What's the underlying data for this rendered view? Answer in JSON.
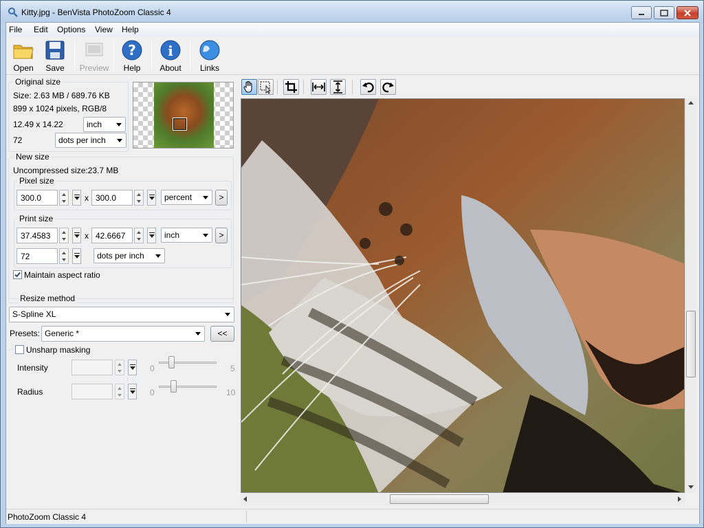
{
  "window": {
    "title": "Kitty.jpg - BenVista PhotoZoom Classic 4"
  },
  "menu": [
    "File",
    "Edit",
    "Options",
    "View",
    "Help"
  ],
  "toolbar": {
    "open": "Open",
    "save": "Save",
    "preview": "Preview",
    "help": "Help",
    "about": "About",
    "links": "Links"
  },
  "original": {
    "title": "Original size",
    "size": "Size: 2.63 MB / 689.76 KB",
    "pixels": "899 x 1024 pixels, RGB/8",
    "dimensions": "12.49 x 14.22",
    "unit": "inch",
    "resolution": "72",
    "res_unit": "dots per inch"
  },
  "newsize": {
    "title": "New size",
    "uncompressed": "Uncompressed size:23.7 MB",
    "pixel_title": "Pixel size",
    "pixel_w": "300.0",
    "pixel_h": "300.0",
    "pixel_unit": "percent",
    "x": "x",
    "more": ">",
    "print_title": "Print size",
    "print_w": "37.4583",
    "print_h": "42.6667",
    "print_unit": "inch",
    "print_res": "72",
    "print_res_unit": "dots per inch",
    "aspect": "Maintain aspect ratio",
    "aspect_checked": true
  },
  "resize": {
    "title": "Resize method",
    "method": "S-Spline XL",
    "presets_label": "Presets:",
    "preset": "Generic *",
    "collapse": "<<"
  },
  "unsharp": {
    "title": "Unsharp masking",
    "intensity_label": "Intensity",
    "intensity_min": "0",
    "intensity_max": "5",
    "radius_label": "Radius",
    "radius_min": "0",
    "radius_max": "10",
    "intensity_level": 0.35,
    "radius_level": 0.3
  },
  "status": {
    "text": "PhotoZoom Classic 4"
  },
  "colors": {
    "accent": "#2f6fc5",
    "titlebar": "#c5d9ef"
  }
}
